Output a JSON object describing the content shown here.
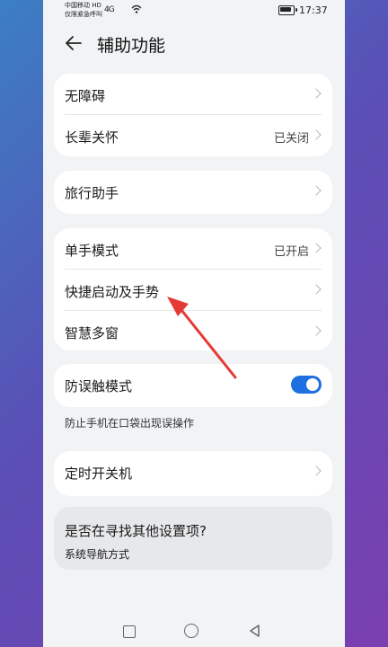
{
  "status_bar": {
    "carrier_line1": "中国移动 HD",
    "carrier_line2": "仅限紧急呼叫",
    "signal": "4G",
    "time": "17:37"
  },
  "header": {
    "title": "辅助功能"
  },
  "group1": [
    {
      "label": "无障碍",
      "value": ""
    },
    {
      "label": "长辈关怀",
      "value": "已关闭"
    }
  ],
  "group2": [
    {
      "label": "旅行助手",
      "value": ""
    }
  ],
  "group3": [
    {
      "label": "单手模式",
      "value": "已开启"
    },
    {
      "label": "快捷启动及手势",
      "value": ""
    },
    {
      "label": "智慧多窗",
      "value": ""
    }
  ],
  "group4": {
    "label": "防误触模式",
    "toggle_on": true,
    "note": "防止手机在口袋出现误操作"
  },
  "group5": [
    {
      "label": "定时开关机",
      "value": ""
    }
  ],
  "suggest": {
    "question": "是否在寻找其他设置项?",
    "link": "系统导航方式"
  },
  "colors": {
    "accent": "#1e6fe0",
    "arrow": "#e53935"
  },
  "icons": [
    "back-arrow-icon",
    "chevron-right-icon",
    "wifi-icon",
    "battery-icon",
    "nav-square-icon",
    "nav-home-icon",
    "nav-back-icon"
  ]
}
